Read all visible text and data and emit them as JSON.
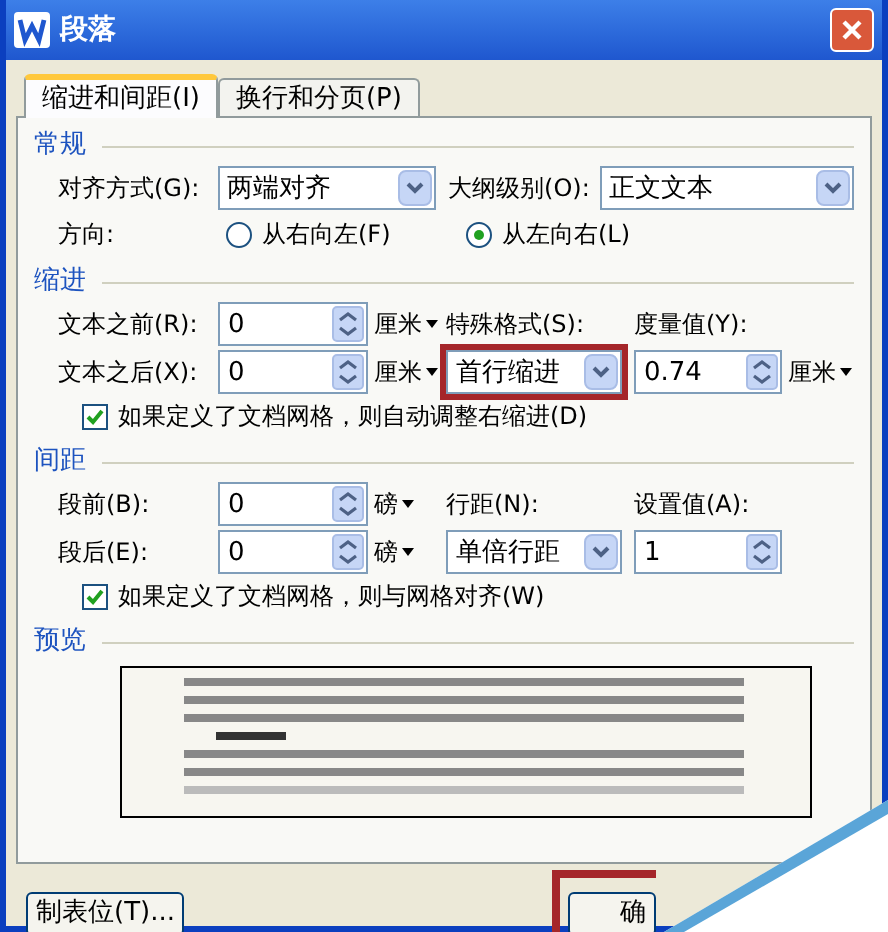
{
  "window": {
    "title": "段落"
  },
  "tabs": [
    {
      "label": "缩进和间距(I)",
      "selected": true
    },
    {
      "label": "换行和分页(P)",
      "selected": false
    }
  ],
  "general": {
    "title": "常规",
    "alignment": {
      "label": "对齐方式(G):",
      "value": "两端对齐"
    },
    "outline_level": {
      "label": "大纲级别(O):",
      "value": "正文文本"
    },
    "direction": {
      "label": "方向:",
      "options": [
        {
          "label": "从右向左(F)",
          "selected": false
        },
        {
          "label": "从左向右(L)",
          "selected": true
        }
      ]
    }
  },
  "indent": {
    "title": "缩进",
    "before": {
      "label": "文本之前(R):",
      "value": "0",
      "unit": "厘米"
    },
    "after": {
      "label": "文本之后(X):",
      "value": "0",
      "unit": "厘米"
    },
    "special": {
      "label": "特殊格式(S):",
      "value": "首行缩进",
      "highlighted": true
    },
    "measure": {
      "label": "度量值(Y):",
      "value": "0.74",
      "unit": "厘米"
    },
    "grid_check": {
      "label": "如果定义了文档网格，则自动调整右缩进(D)",
      "checked": true
    }
  },
  "spacing": {
    "title": "间距",
    "before": {
      "label": "段前(B):",
      "value": "0",
      "unit": "磅"
    },
    "after": {
      "label": "段后(E):",
      "value": "0",
      "unit": "磅"
    },
    "line_spacing": {
      "label": "行距(N):",
      "value": "单倍行距"
    },
    "set_value": {
      "label": "设置值(A):",
      "value": "1"
    },
    "grid_check": {
      "label": "如果定义了文档网格，则与网格对齐(W)",
      "checked": true
    }
  },
  "preview": {
    "title": "预览"
  },
  "buttons": [
    {
      "label": "制表位(T)..."
    },
    {
      "label": "确",
      "highlighted": true
    }
  ]
}
